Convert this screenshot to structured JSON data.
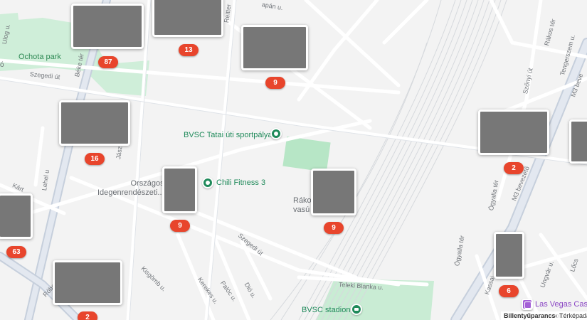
{
  "map": {
    "labels": {
      "park": "Ochota park",
      "road_ulog": "Ulog u.",
      "road_szegedi_top": "Szegedi út",
      "road_beke": "Béke tér",
      "road_reitter": "Reitter",
      "road_japan": "apán u.",
      "road_rakos_ter": "Rákos tér",
      "road_tengerszem": "Tengerszem u.",
      "road_szonyi": "Szőnyi út",
      "road_m3top": "M3 beve",
      "road_jasz": "Jász",
      "road_lehel": "Lehel u",
      "road_kart": "Kárt",
      "road_szegedi_mid": "Szegedi út",
      "road_kisgomb": "Kisgömb u.",
      "road_kerekes": "Kerekes u.",
      "road_paloc": "Palóc u.",
      "road_dio": "Dió u.",
      "road_robert": "Róbert Károly",
      "road_teleki": "Teleki Blanka u.",
      "road_ogyalla1": "Ógyalla tér",
      "road_ogyalla2": "Ógyalla tér",
      "road_m3bev": "M3 bevezető",
      "road_kassai": "Kassai",
      "road_ungvar": "Ungvár u.",
      "road_locs": "Lőcs",
      "orszagos": "Országos\nIdegenrendészeti...",
      "rako": "Ráko\nvasú",
      "partial_left": "ó",
      "bvsc_tatai": "BVSC Tatai úti sportpálya",
      "chili": "Chili Fitness 3",
      "bvsc_stadion": "BVSC stadion",
      "las_vegas": "Las Vegas Casi"
    },
    "markers": [
      {
        "count": "87",
        "photo": "boat"
      },
      {
        "count": "13",
        "photo": "group"
      },
      {
        "count": "9",
        "photo": "street"
      },
      {
        "count": "16",
        "photo": "shop"
      },
      {
        "count": "9",
        "photo": "crowd"
      },
      {
        "count": "9",
        "photo": "aerial"
      },
      {
        "count": "2",
        "photo": "building"
      },
      {
        "count": "6",
        "photo": "tower"
      },
      {
        "count": "2",
        "photo": "kids"
      },
      {
        "count": "63",
        "photo": "door"
      },
      {
        "count": "",
        "photo": "edge"
      }
    ],
    "attribution": {
      "shortcuts": "Billentyűparancsok",
      "mapdata": "Térképadato"
    },
    "colors": {
      "background": "#f3f3f3",
      "road": "#ffffff",
      "road_outline": "#d9dde3",
      "major_road": "#dbe1ea",
      "park": "#c9ecd4",
      "badge": "#e8452c",
      "poi_green": "#1f8a5a",
      "poi_purple": "#a45fd6"
    }
  }
}
